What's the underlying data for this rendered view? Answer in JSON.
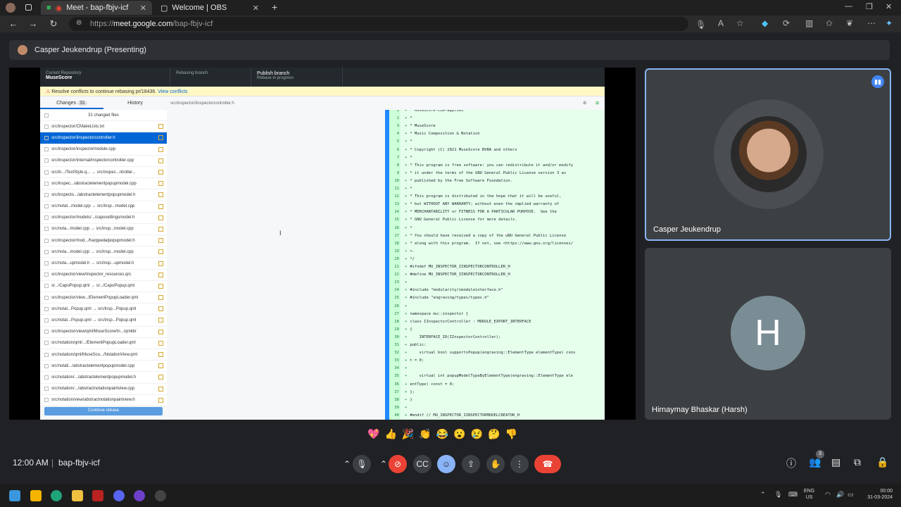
{
  "browser": {
    "tabs": [
      {
        "label": "Meet - bap-fbjv-icf",
        "active": true
      },
      {
        "label": "Welcome | OBS",
        "active": false
      }
    ],
    "url_prefix": "https://",
    "url_host": "meet.google.com",
    "url_path": "/bap-fbjv-icf"
  },
  "meet": {
    "presenting_label": "Casper Jeukendrup (Presenting)",
    "participants": [
      {
        "name": "Casper Jeukendrup",
        "speaking": true
      },
      {
        "name": "Hirnaymay Bhaskar (Harsh)",
        "initial": "H"
      }
    ],
    "time": "12:00 AM",
    "meeting_code": "bap-fbjv-icf",
    "people_count": "3",
    "reactions": [
      "💖",
      "👍",
      "🎉",
      "👏",
      "😂",
      "😮",
      "😢",
      "🤔",
      "👎"
    ]
  },
  "shared_app": {
    "repo_label": "Current Repository",
    "repo_name": "MuseScore",
    "branch_label": "Rebasing branch",
    "publish_label": "Publish branch",
    "publish_sub": "Rebase in progress",
    "banner_text": "Resolve conflicts to continue rebasing pr/18436.",
    "banner_link": "View conflicts",
    "tab_changes": "Changes",
    "tab_changes_count": "31",
    "tab_history": "History",
    "changed_files": "31 changed files",
    "path": "src/inspector/iinspectorcontroller.h",
    "continue_button": "Continue rebase",
    "files": [
      "src/inspector/CMakeLists.txt",
      "src/inspector/iinspectorcontroller.h",
      "src/inspector/inspectormodule.cpp",
      "src/inspector/internal/inspectorcontroller.cpp",
      "src/in.../TextStyle.q... → src/inspec...ntroller...",
      "src/inspec.../abstractelementpopupmodel.cpp",
      "src/inspecto.../abstractelementpopupmodel.h",
      "src/notat...model.cpp → src/insp...model.cpp",
      "src/inspector/models/.../caposettingsmodel.h",
      "src/nota...model.cpp → src/insp...model.cpp",
      "src/inspector/mod.../harppedalpopupmodel.h",
      "src/nota...model.cpp → src/insp...model.cpp",
      "src/nota...upmodel.h → src/insp...upmodel.h",
      "src/inspector/view/inspector_resources.qrc",
      "sr.../CapoPopup.qml → sr.../CapoPopup.qml",
      "src/inspector/view.../ElementPopupLoader.qml",
      "src/notat...Popup.qml → src/insp...Popup.qml",
      "src/notat...Popup.qml → src/insp...Popup.qml",
      "src/inspector/view/qml/MuseScore/In.../qmldir",
      "src/notation/qml/.../ElementPopupLoader.qml",
      "src/notation/qml/MuseSco.../NotationView.qml",
      "src/notati.../abstractelementpopupmodel.cpp",
      "src/notation/.../abstractelementpopupmodel.h",
      "src/notation/.../abstractnotationpaintview.cpp",
      "src/notation/view/abstractnotationpaintview.h"
    ],
    "code_lines": [
      "* MuseScore-CLA-applies",
      "*",
      "* MuseScore",
      "* Music Composition & Notation",
      "*",
      "* Copyright (C) 2021 MuseScore BVBA and others",
      "*",
      "* This program is free software: you can redistribute it and/or modify",
      "* it under the terms of the GNU General Public License version 3 as",
      "* published by the Free Software Foundation.",
      "*",
      "* This program is distributed in the hope that it will be useful,",
      "* but WITHOUT ANY WARRANTY; without even the implied warranty of",
      "* MERCHANTABILITY or FITNESS FOR A PARTICULAR PURPOSE.  See the",
      "* GNU General Public License for more details.",
      "*",
      "* You should have received a copy of the GNU General Public License",
      "* along with this program.  If not, see <https://www.gnu.org/licenses/",
      ">.",
      "*/",
      "#ifndef MU_INSPECTOR_IINSPECTORCONTROLLER_H",
      "#define MU_INSPECTOR_IINSPECTORCONTROLLER_H",
      "",
      "#include \"modularity/imoduleinterface.h\"",
      "#include \"engraving/types/types.h\"",
      "",
      "namespace mu::inspector {",
      "class IInspectorController : MODULE_EXPORT_INTERFACE",
      "{",
      "    INTERFACE_ID(IInspectorController);",
      "public:",
      "    virtual bool supportsPopup(engraving::ElementType elementType) cons",
      "t = 0;",
      "",
      "    virtual int popupModelTypeByElementType(engraving::ElementType ele",
      "entType) const = 0;",
      "};",
      "}",
      "",
      "#endif // MU_INSPECTOR_IINSPECTORMODELCREATOR_H"
    ]
  },
  "taskbar": {
    "lang": "ENG",
    "region": "US",
    "time": "00:00",
    "date": "31-03-2024"
  },
  "colors": {
    "accent": "#8ab4f8",
    "end_call": "#ea4335",
    "diff_add": "#e6ffed"
  }
}
